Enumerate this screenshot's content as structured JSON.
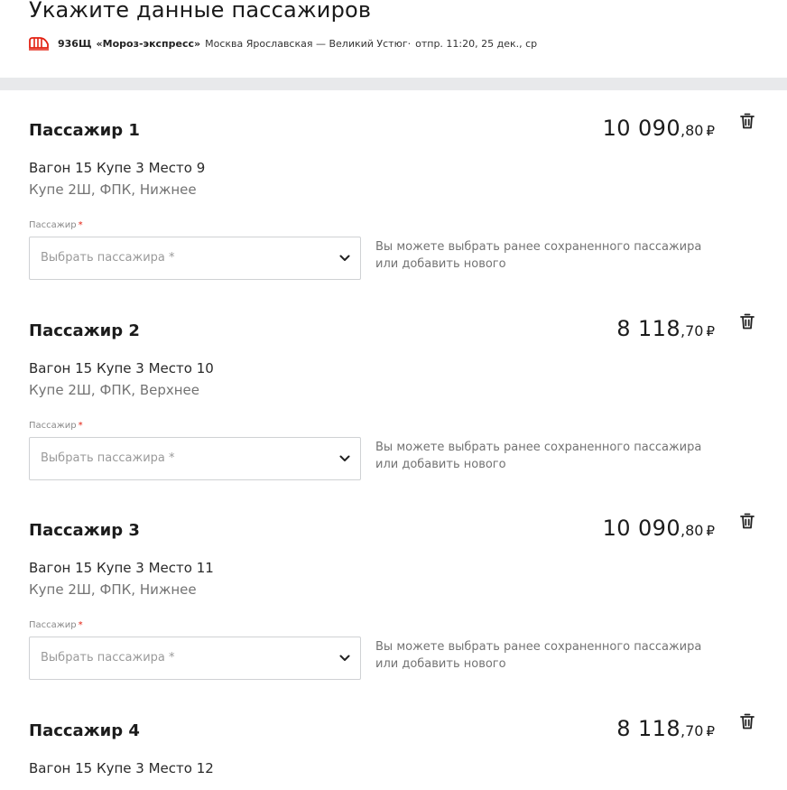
{
  "page": {
    "title": "Укажите данные пассажиров"
  },
  "train": {
    "number": "936Щ",
    "name": "«Мороз-экспресс»",
    "route": "Москва Ярославская — Великий Устюг",
    "separator": "·",
    "departure": "отпр. 11:20, 25 дек., ср",
    "icon": "train-icon",
    "icon_color": "#e32112"
  },
  "colors": {
    "accent": "#e32112",
    "band": "#e8e9eb",
    "border": "#cfd1d4",
    "muted_text": "#737373"
  },
  "passengers": [
    {
      "title": "Пассажир 1",
      "price_main": "10 090",
      "price_cents": ",80",
      "currency": "₽",
      "seat": "Вагон 15 Купе 3 Место 9",
      "car_class": "Купе 2Ш, ФПК, Нижнее",
      "field_label": "Пассажир",
      "required_mark": "*",
      "select_placeholder": "Выбрать пассажира *",
      "hint_line1": "Вы можете выбрать ранее сохраненного пассажира",
      "hint_line2": "или добавить нового"
    },
    {
      "title": "Пассажир 2",
      "price_main": "8 118",
      "price_cents": ",70",
      "currency": "₽",
      "seat": "Вагон 15 Купе 3 Место 10",
      "car_class": "Купе 2Ш, ФПК, Верхнее",
      "field_label": "Пассажир",
      "required_mark": "*",
      "select_placeholder": "Выбрать пассажира *",
      "hint_line1": "Вы можете выбрать ранее сохраненного пассажира",
      "hint_line2": "или добавить нового"
    },
    {
      "title": "Пассажир 3",
      "price_main": "10 090",
      "price_cents": ",80",
      "currency": "₽",
      "seat": "Вагон 15 Купе 3 Место 11",
      "car_class": "Купе 2Ш, ФПК, Нижнее",
      "field_label": "Пассажир",
      "required_mark": "*",
      "select_placeholder": "Выбрать пассажира *",
      "hint_line1": "Вы можете выбрать ранее сохраненного пассажира",
      "hint_line2": "или добавить нового"
    },
    {
      "title": "Пассажир 4",
      "price_main": "8 118",
      "price_cents": ",70",
      "currency": "₽",
      "seat": "Вагон 15 Купе 3 Место 12"
    }
  ]
}
